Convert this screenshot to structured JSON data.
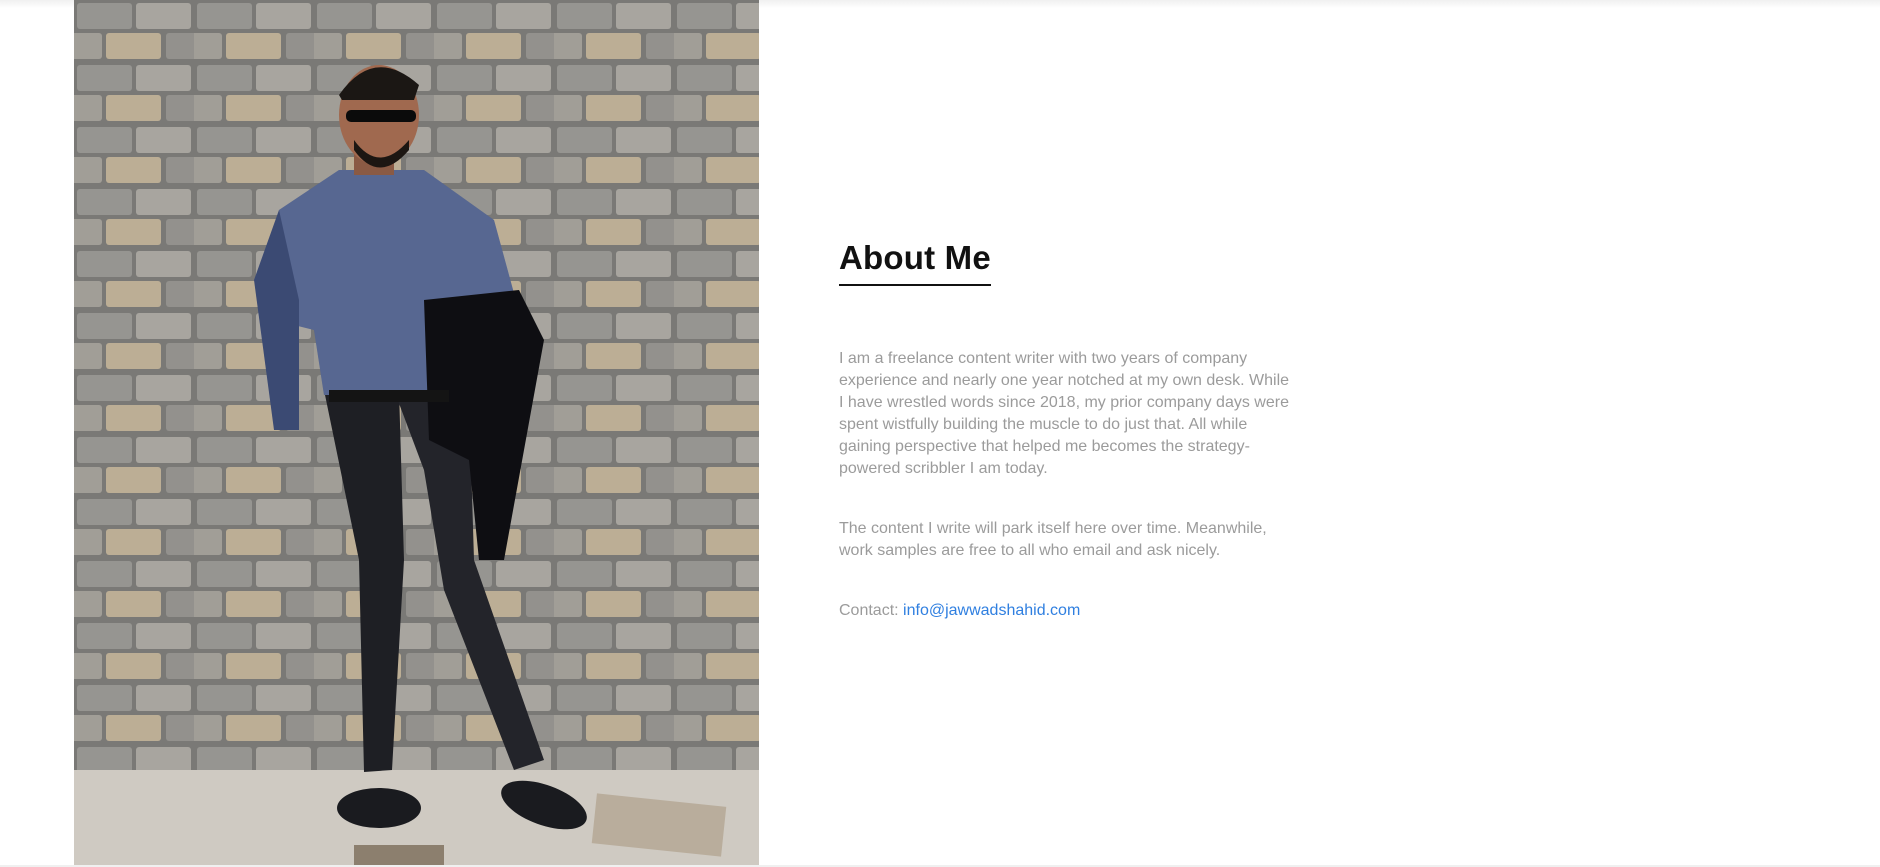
{
  "about": {
    "heading": "About Me",
    "paragraph_1": "I am a freelance content writer with two years of company experience and nearly one year notched at my own desk. While I have wrestled words since 2018, my prior company days were spent wistfully building the muscle to do just that. All while gaining perspective that helped me becomes the strategy-powered scribbler I am today.",
    "paragraph_2": "The content I write will park itself here over time. Meanwhile, work samples are free to all who email and ask nicely.",
    "contact_label": "Contact:",
    "contact_email": "info@jawwadshahid.com"
  },
  "colors": {
    "heading": "#111111",
    "body_text": "#9b9b9b",
    "link": "#2f7fe0",
    "background": "#ffffff"
  }
}
